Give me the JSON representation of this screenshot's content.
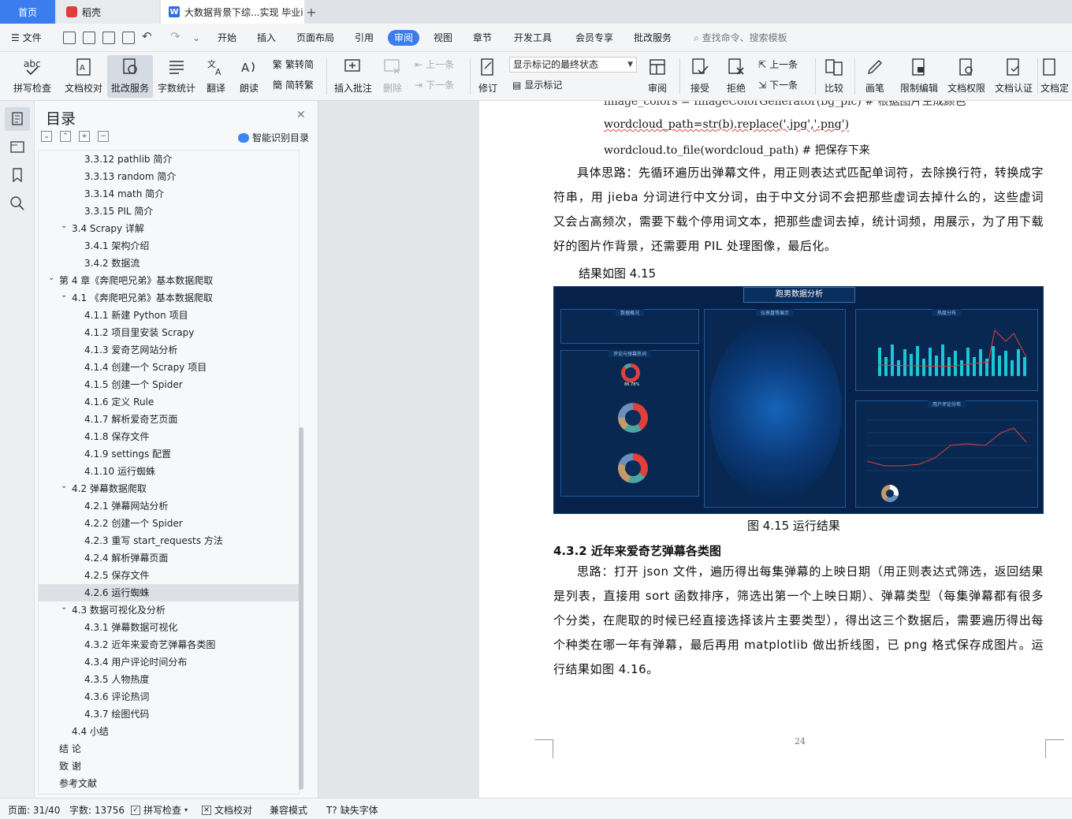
{
  "tabs": {
    "home": "首页",
    "daoke": "稻壳",
    "document": "大数据背景下综...实现 毕业i",
    "add": "+"
  },
  "menu": {
    "file": "文件",
    "items": [
      "开始",
      "插入",
      "页面布局",
      "引用",
      "审阅",
      "视图",
      "章节",
      "开发工具",
      "会员专享",
      "批改服务"
    ],
    "active": "审阅",
    "search": "查找命令、搜索模板"
  },
  "ribbon": {
    "spellcheck": "拼写检查",
    "doc_proof": "文档校对",
    "revise_service": "批改服务",
    "word_count": "字数统计",
    "translate": "翻译",
    "read_aloud": "朗读",
    "trad_to_simp": "繁转简",
    "simp_to_trad": "简转繁",
    "insert_comment": "插入批注",
    "delete": "删除",
    "prev_comment": "上一条",
    "next_comment": "下一条",
    "track_changes": "修订",
    "markup_state": "显示标记的最终状态",
    "show_markup": "显示标记",
    "review": "审阅",
    "accept": "接受",
    "reject": "拒绝",
    "prev_change": "上一条",
    "next_change": "下一条",
    "compare": "比较",
    "pen": "画笔",
    "restrict_edit": "限制编辑",
    "doc_permission": "文档权限",
    "doc_auth": "文档认证",
    "doc_final": "文档定"
  },
  "toc": {
    "title": "目录",
    "smart_detect": "智能识别目录",
    "items": [
      {
        "label": "3.3.12 pathlib 简介",
        "level": 3
      },
      {
        "label": "3.3.13 random 简介",
        "level": 3
      },
      {
        "label": "3.3.14 math 简介",
        "level": 3
      },
      {
        "label": "3.3.15 PIL 简介",
        "level": 3
      },
      {
        "label": "3.4 Scrapy 详解",
        "level": 2,
        "expanded": true
      },
      {
        "label": "3.4.1   架构介绍",
        "level": 3
      },
      {
        "label": "3.4.2   数据流",
        "level": 3
      },
      {
        "label": "第 4 章《奔爬吧兄弟》基本数据爬取",
        "level": 1,
        "expanded": true
      },
      {
        "label": "4.1  《奔爬吧兄弟》基本数据爬取",
        "level": 2,
        "expanded": true
      },
      {
        "label": "4.1.1    新建 Python 项目",
        "level": 3
      },
      {
        "label": "4.1.2    项目里安装 Scrapy",
        "level": 3
      },
      {
        "label": "4.1.3    爱奇艺网站分析",
        "level": 3
      },
      {
        "label": "4.1.4    创建一个 Scrapy 项目",
        "level": 3
      },
      {
        "label": "4.1.5    创建一个 Spider",
        "level": 3
      },
      {
        "label": "4.1.6    定义 Rule",
        "level": 3
      },
      {
        "label": "4.1.7    解析爱奇艺页面",
        "level": 3
      },
      {
        "label": "4.1.8    保存文件",
        "level": 3
      },
      {
        "label": "4.1.9    settings 配置",
        "level": 3
      },
      {
        "label": "4.1.10    运行蜘蛛",
        "level": 3
      },
      {
        "label": "4.2  弹幕数据爬取",
        "level": 2,
        "expanded": true
      },
      {
        "label": "4.2.1    弹幕网站分析",
        "level": 3
      },
      {
        "label": "4.2.2    创建一个 Spider",
        "level": 3
      },
      {
        "label": "4.2.3    重写 start_requests 方法",
        "level": 3
      },
      {
        "label": "4.2.4    解析弹幕页面",
        "level": 3
      },
      {
        "label": "4.2.5    保存文件",
        "level": 3
      },
      {
        "label": "4.2.6    运行蜘蛛",
        "level": 3,
        "selected": true
      },
      {
        "label": "4.3  数据可视化及分析",
        "level": 2,
        "expanded": true
      },
      {
        "label": "4.3.1    弹幕数据可视化",
        "level": 3
      },
      {
        "label": "4.3.2    近年来爱奇艺弹幕各类图",
        "level": 3
      },
      {
        "label": "4.3.4    用户评论时间分布",
        "level": 3
      },
      {
        "label": "4.3.5    人物热度",
        "level": 3
      },
      {
        "label": "4.3.6    评论热词",
        "level": 3
      },
      {
        "label": "4.3.7    绘图代码",
        "level": 3
      },
      {
        "label": "4.4    小结",
        "level": 2
      },
      {
        "label": "结    论",
        "level": 1
      },
      {
        "label": "致    谢",
        "level": 1
      },
      {
        "label": "参考文献",
        "level": 1
      }
    ]
  },
  "document": {
    "code_partial": "image_colors = ImageColorGenerator(bg_pic)   # 根据图片生成颜色",
    "code_line1": "wordcloud_path=str(b).replace('.jpg','.png')",
    "code_line2": "wordcloud.to_file(wordcloud_path)   # 把保存下来",
    "para1": "具体思路：先循环遍历出弹幕文件，用正则表达式匹配单词符，去除换行符，转换成字符串，用 jieba 分词进行中文分词，由于中文分词不会把那些虚词去掉什么的，这些虚词又会占高频次，需要下载个停用词文本，把那些虚词去掉，统计词频，用展示，为了用下载好的图片作背景，还需要用 PIL 处理图像，最后化。",
    "result_intro": "结果如图 4.15",
    "figure": {
      "title": "跑男数据分析",
      "panel_overview": "数据概况",
      "panel_center": "仪表盘等展示",
      "panel_hot": "热度分布",
      "panel_comments": "评论与弹幕热词",
      "panel_user": "用户评论分布",
      "donut_pct": "86.78%"
    },
    "caption": "图 4.15    运行结果",
    "section_heading": "4.3.2    近年来爱奇艺弹幕各类图",
    "para2": "思路：打开 json 文件，遍历得出每集弹幕的上映日期（用正则表达式筛选，返回结果是列表，直接用 sort 函数排序，筛选出第一个上映日期）、弹幕类型（每集弹幕都有很多个分类，在爬取的时候已经直接选择该片主要类型），得出这三个数据后，需要遍历得出每个种类在哪一年有弹幕，最后再用 matplotlib 做出折线图，已 png 格式保存成图片。运行结果如图 4.16。",
    "page_number": "24"
  },
  "status": {
    "page": "页面: 31/40",
    "words": "字数: 13756",
    "spellcheck": "拼写检查",
    "proof": "文档校对",
    "compat": "兼容模式",
    "missing_font": "缺失字体"
  },
  "colors": {
    "accent": "#3b7df0",
    "figure_bg": "#07224a",
    "donut_red": "#e0403a",
    "donut_teal": "#4fa3a0"
  }
}
